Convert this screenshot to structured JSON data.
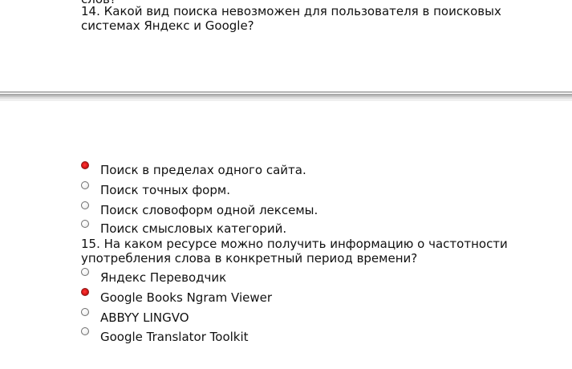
{
  "top_fragment": "слов?",
  "questions": [
    {
      "text": "14. Какой вид поиска невозможен для пользователя в поисковых системах Яндекс и Google?",
      "options": [
        {
          "label": "Поиск в пределах одного сайта.",
          "selected": true
        },
        {
          "label": "Поиск точных форм.",
          "selected": false
        },
        {
          "label": "Поиск словоформ одной лексемы.",
          "selected": false
        },
        {
          "label": "Поиск смысловых категорий.",
          "selected": false
        }
      ]
    },
    {
      "text": "15. На каком ресурсе можно получить информацию о частотности употребления слова в конкретный период времени?",
      "options": [
        {
          "label": "Яндекс Переводчик",
          "selected": false
        },
        {
          "label": "Google Books Ngram Viewer",
          "selected": true
        },
        {
          "label": "ABBYY LINGVO",
          "selected": false
        },
        {
          "label": "Google Translator Toolkit",
          "selected": false
        }
      ]
    }
  ],
  "colors": {
    "selected_radio": "#e21b1b",
    "text": "#111111",
    "divider": "#b0b0b0"
  }
}
